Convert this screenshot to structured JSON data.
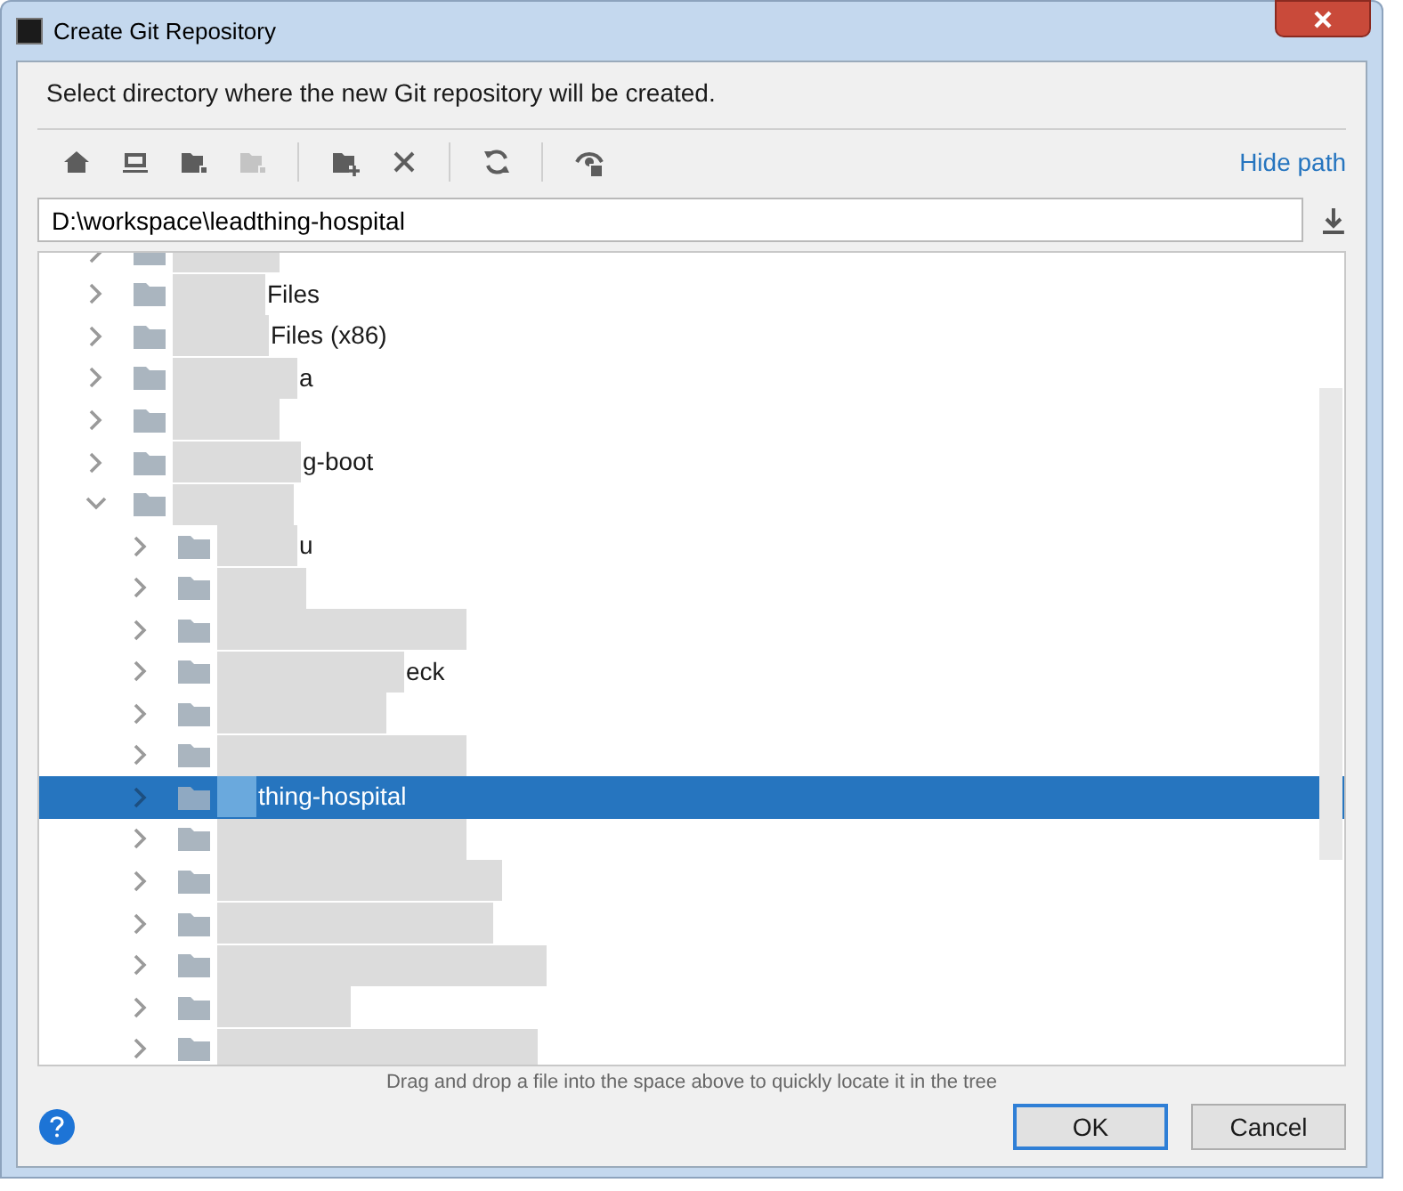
{
  "window": {
    "title": "Create Git Repository"
  },
  "prompt": "Select directory where the new Git repository will be created.",
  "toolbar": [
    {
      "kind": "home",
      "disabled": false
    },
    {
      "kind": "desktop",
      "disabled": false
    },
    {
      "kind": "project",
      "disabled": false
    },
    {
      "kind": "module",
      "disabled": true
    },
    {
      "kind": "separator"
    },
    {
      "kind": "new-folder",
      "disabled": false
    },
    {
      "kind": "delete",
      "disabled": false
    },
    {
      "kind": "separator"
    },
    {
      "kind": "refresh",
      "disabled": false
    },
    {
      "kind": "separator"
    },
    {
      "kind": "hidden-files",
      "disabled": false
    }
  ],
  "hide_path_link": "Hide path",
  "path_field": {
    "value": "D:\\workspace\\leadthing-hospital"
  },
  "tree": [
    {
      "expanded": false,
      "selected": false
    },
    {
      "text": "Files",
      "expanded": false,
      "selected": false
    },
    {
      "text": "Files (x86)",
      "expanded": false,
      "selected": false
    },
    {
      "text": "a",
      "expanded": false,
      "selected": false
    },
    {
      "expanded": false,
      "selected": false
    },
    {
      "text": "g-boot",
      "expanded": false,
      "selected": false
    },
    {
      "expanded": true,
      "selected": false,
      "children": [
        {
          "text": "u",
          "expanded": false,
          "selected": false
        },
        {
          "expanded": false,
          "selected": false
        },
        {
          "expanded": false,
          "selected": false
        },
        {
          "text": "eck",
          "expanded": false,
          "selected": false
        },
        {
          "expanded": false,
          "selected": false
        },
        {
          "expanded": false,
          "selected": false
        },
        {
          "text": "thing-hospital",
          "expanded": false,
          "selected": true
        },
        {
          "expanded": false,
          "selected": false
        },
        {
          "expanded": false,
          "selected": false
        },
        {
          "expanded": false,
          "selected": false
        },
        {
          "expanded": false,
          "selected": false
        },
        {
          "expanded": false,
          "selected": false
        },
        {
          "expanded": false,
          "selected": false
        }
      ]
    }
  ],
  "hint": "Drag and drop a file into the space above to quickly locate it in the tree",
  "buttons": [
    {
      "label": "OK",
      "default": true
    },
    {
      "label": "Cancel",
      "default": false
    }
  ]
}
